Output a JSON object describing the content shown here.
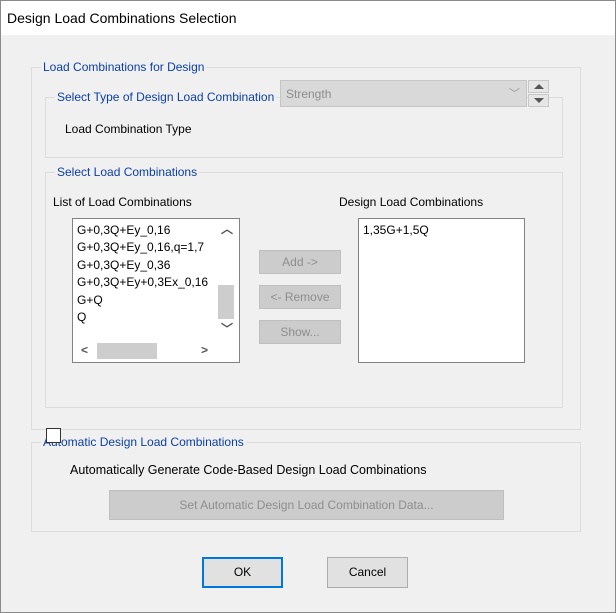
{
  "window": {
    "title": "Design Load Combinations Selection"
  },
  "group_design": {
    "legend": "Load Combinations for Design"
  },
  "group_type": {
    "legend": "Select Type of Design Load Combination",
    "label": "Load Combination Type",
    "value": "Strength"
  },
  "group_select": {
    "legend": "Select Load Combinations",
    "list_label": "List of Load Combinations",
    "design_label": "Design Load Combinations",
    "list_items": [
      "G+0,3Q+Ey_0,16",
      "G+0,3Q+Ey_0,16,q=1,7",
      "G+0,3Q+Ey_0,36",
      "G+0,3Q+Ey+0,3Ex_0,16",
      "G+Q",
      "Q"
    ],
    "design_items": [
      "1,35G+1,5Q"
    ],
    "add_label": "Add ->",
    "remove_label": "<- Remove",
    "show_label": "Show..."
  },
  "group_auto": {
    "legend": "Automatic Design Load Combinations",
    "checkbox_label": "Automatically Generate Code-Based Design Load Combinations",
    "checked": false,
    "set_data_label": "Set Automatic Design Load Combination Data..."
  },
  "buttons": {
    "ok": "OK",
    "cancel": "Cancel"
  }
}
